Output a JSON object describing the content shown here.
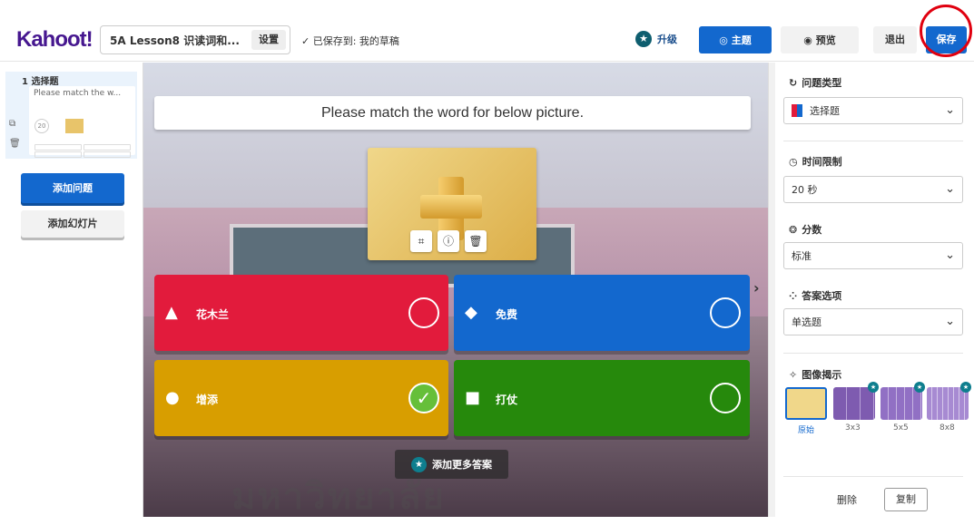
{
  "header": {
    "logo": "Kahoot!",
    "quiz_title": "5A Lesson8 识读词和...",
    "settings_label": "设置",
    "saved_status": "✓ 已保存到: 我的草稿",
    "upgrade_label": "升级",
    "theme_label": "主题",
    "preview_label": "预览",
    "exit_label": "退出",
    "save_label": "保存"
  },
  "sidebar": {
    "slides": [
      {
        "number": "1 选择题",
        "question": "Please match the w...",
        "time": "20"
      }
    ],
    "add_question_label": "添加问题",
    "add_slide_label": "添加幻灯片"
  },
  "editor": {
    "question": "Please match the word for below picture.",
    "answers": [
      {
        "text": "花木兰",
        "shape": "triangle",
        "color": "#e21b3c",
        "correct": false
      },
      {
        "text": "免费",
        "shape": "diamond",
        "color": "#1368ce",
        "correct": false
      },
      {
        "text": "增添",
        "shape": "circle",
        "color": "#d89e00",
        "correct": true
      },
      {
        "text": "打仗",
        "shape": "square",
        "color": "#26890c",
        "correct": false
      }
    ],
    "add_more_answers_label": "添加更多答案",
    "watermark": "มหาวิทยาลัย"
  },
  "settings_panel": {
    "question_type_label": "问题类型",
    "question_type_value": "选择题",
    "time_limit_label": "时间限制",
    "time_limit_value": "20 秒",
    "points_label": "分数",
    "points_value": "标准",
    "answer_options_label": "答案选项",
    "answer_options_value": "单选题",
    "image_reveal_label": "图像揭示",
    "image_reveal_options": [
      "原始",
      "3x3",
      "5x5",
      "8x8"
    ],
    "image_reveal_selected": "原始",
    "delete_label": "删除",
    "duplicate_label": "复制"
  },
  "colors": {
    "brand": "#46178f",
    "primary": "#1368ce",
    "highlight_circle": "#e0000f"
  }
}
